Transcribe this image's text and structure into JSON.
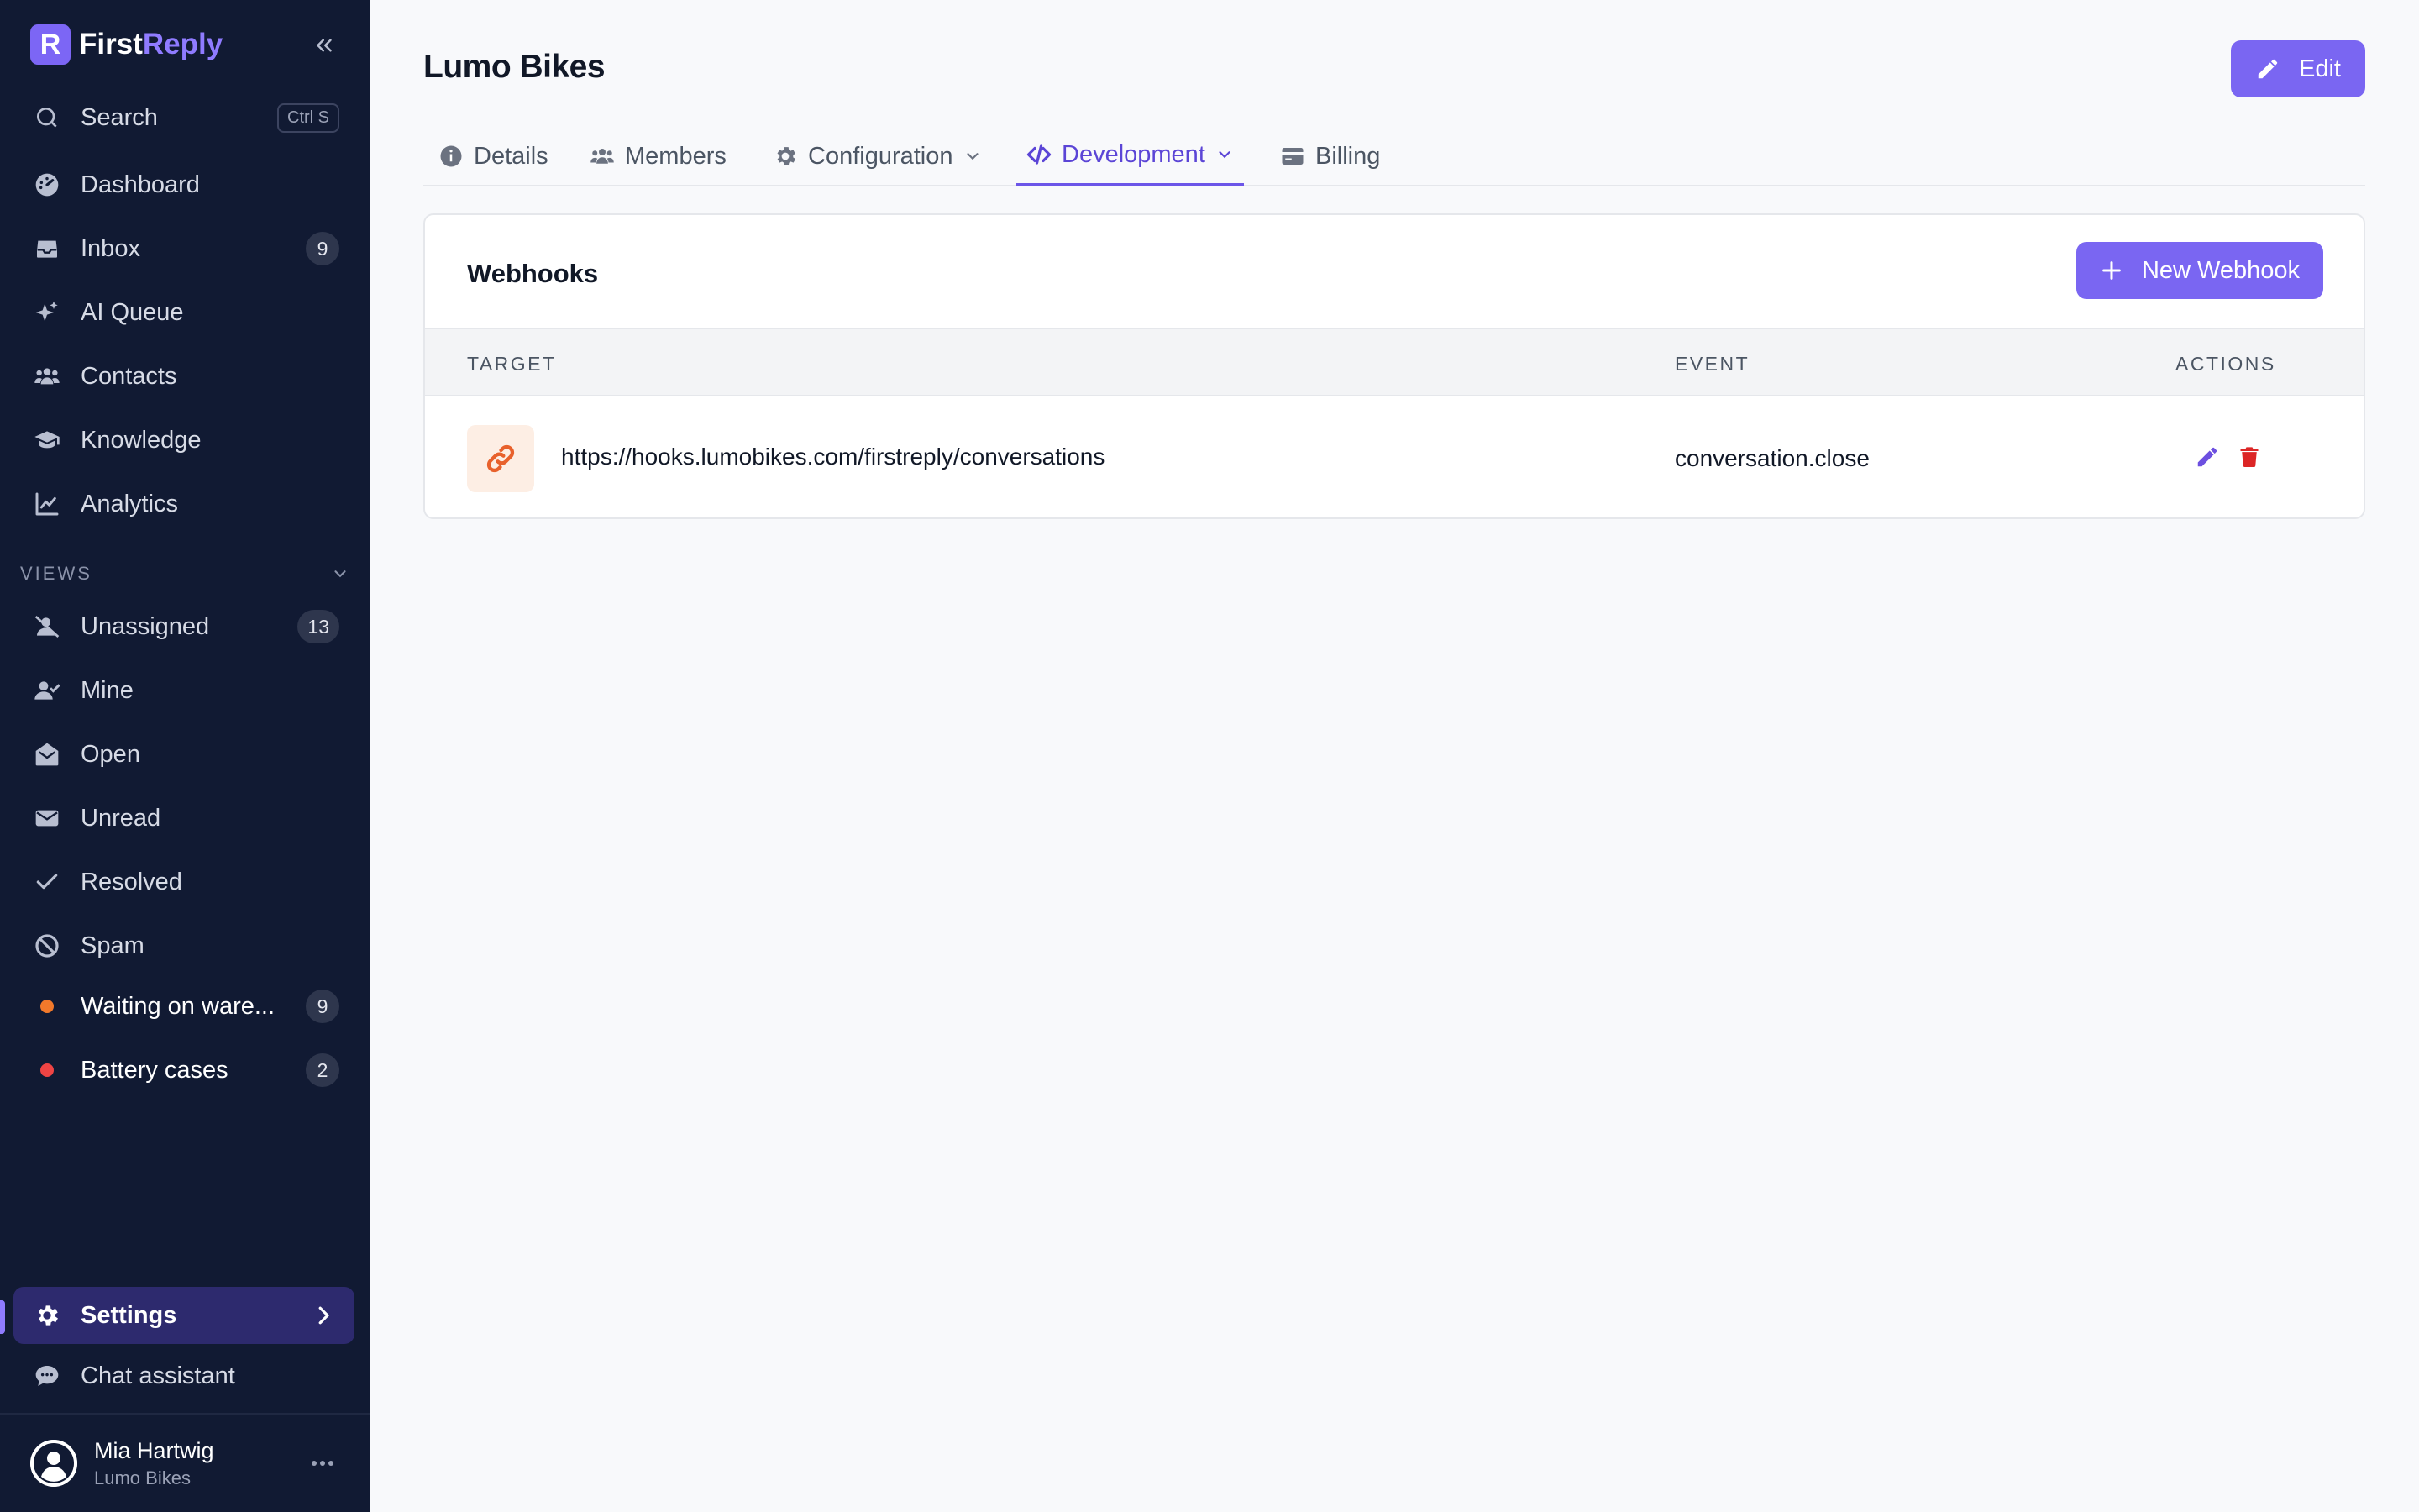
{
  "app": {
    "brand_first": "First",
    "brand_second": "Reply",
    "logo_letter": "R"
  },
  "sidebar": {
    "search_label": "Search",
    "search_shortcut": "Ctrl S",
    "main_items": [
      {
        "label": "Dashboard",
        "icon": "dashboard-icon"
      },
      {
        "label": "Inbox",
        "icon": "inbox-icon",
        "badge": "9"
      },
      {
        "label": "AI Queue",
        "icon": "sparkles-icon"
      },
      {
        "label": "Contacts",
        "icon": "users-icon"
      },
      {
        "label": "Knowledge",
        "icon": "graduation-cap-icon"
      },
      {
        "label": "Analytics",
        "icon": "chart-line-icon"
      }
    ],
    "views_heading": "VIEWS",
    "views": [
      {
        "label": "Unassigned",
        "icon": "user-slash-icon",
        "badge": "13"
      },
      {
        "label": "Mine",
        "icon": "user-check-icon"
      },
      {
        "label": "Open",
        "icon": "envelope-open-icon"
      },
      {
        "label": "Unread",
        "icon": "envelope-icon"
      },
      {
        "label": "Resolved",
        "icon": "check-icon"
      },
      {
        "label": "Spam",
        "icon": "ban-icon"
      },
      {
        "label": "Waiting on ware...",
        "dot_color": "#f2792b",
        "badge": "9"
      },
      {
        "label": "Battery cases",
        "dot_color": "#ef4444",
        "badge": "2"
      }
    ],
    "settings_label": "Settings",
    "chat_label": "Chat assistant",
    "user": {
      "name": "Mia Hartwig",
      "org": "Lumo Bikes"
    }
  },
  "page": {
    "title": "Lumo Bikes",
    "edit_label": "Edit",
    "tabs": [
      {
        "label": "Details"
      },
      {
        "label": "Members"
      },
      {
        "label": "Configuration"
      },
      {
        "label": "Development"
      },
      {
        "label": "Billing"
      }
    ],
    "active_tab": "Development"
  },
  "webhooks": {
    "title": "Webhooks",
    "new_label": "New Webhook",
    "columns": {
      "target": "TARGET",
      "event": "EVENT",
      "actions": "ACTIONS"
    },
    "rows": [
      {
        "target": "https://hooks.lumobikes.com/firstreply/conversations",
        "event": "conversation.close"
      }
    ]
  },
  "colors": {
    "accent": "#7a66f2",
    "sidebar_bg": "#111a33",
    "delete": "#dc2626",
    "link_icon": "#e8612c"
  }
}
